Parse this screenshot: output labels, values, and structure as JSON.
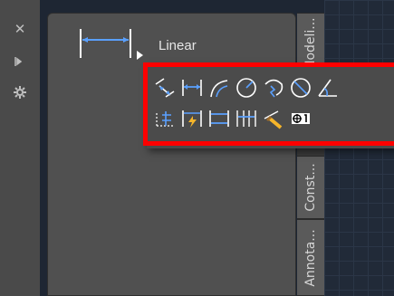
{
  "linear_tool": {
    "label": "Linear",
    "icon": "linear-dimension-icon"
  },
  "left_strip": {
    "icons": [
      "close-icon",
      "auto-hide-icon",
      "properties-icon"
    ]
  },
  "palette_tabs": [
    "Modeli...",
    "Const...",
    "Annota..."
  ],
  "flyout": {
    "row1": [
      "aligned-dimension-icon",
      "linear-dimension-icon",
      "arc-length-icon",
      "radius-icon",
      "jogged-icon",
      "diameter-icon",
      "angular-icon"
    ],
    "row2": [
      "ordinate-icon",
      "quick-dimension-icon",
      "baseline-icon",
      "continue-icon",
      "dimension-style-icon",
      "tolerance-icon"
    ],
    "tolerance_glyph": "⊕1"
  },
  "colors": {
    "highlight": "#ff0000",
    "icon_blue": "#5aa0ff",
    "panel": "#505050"
  }
}
